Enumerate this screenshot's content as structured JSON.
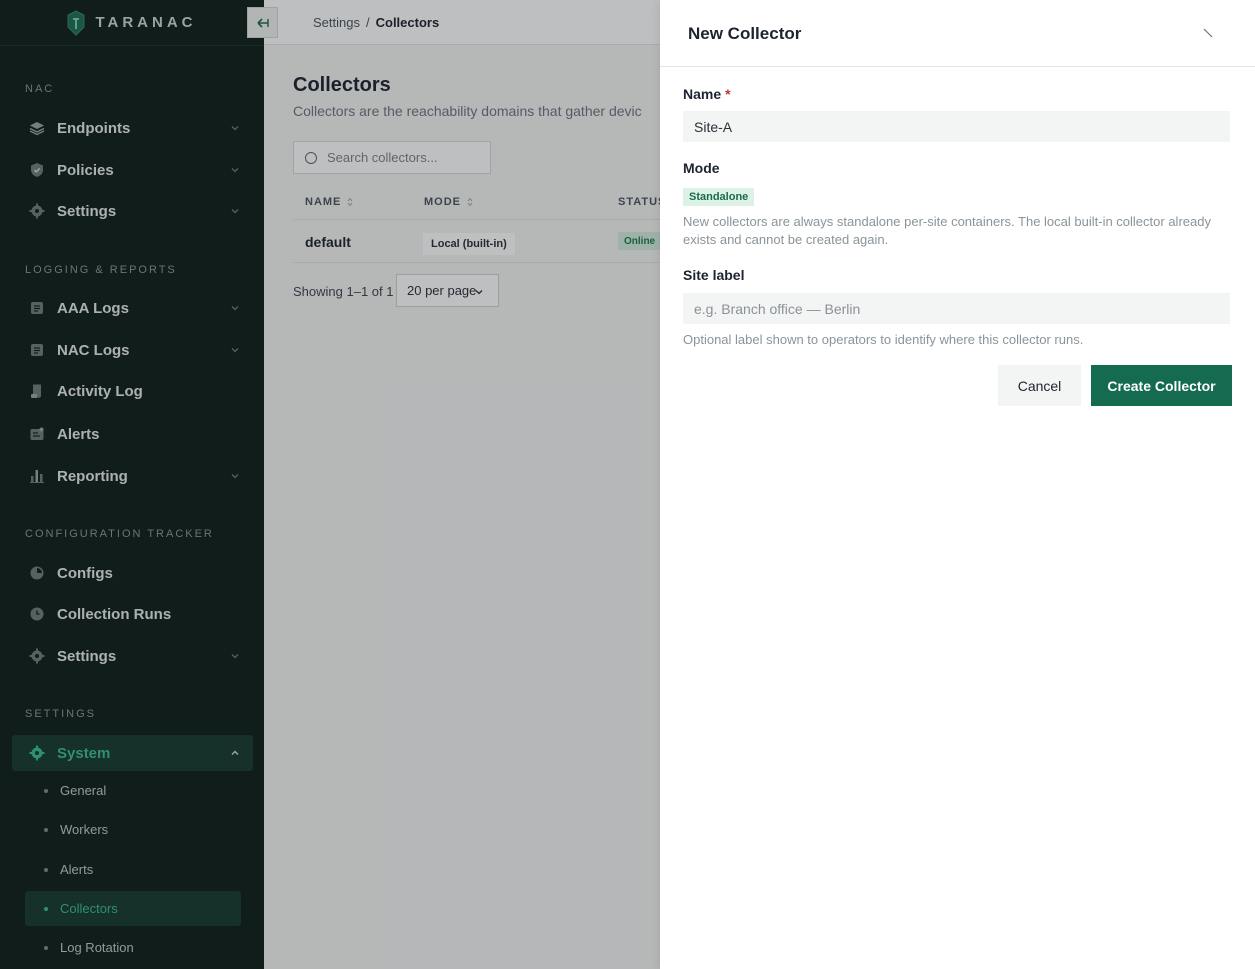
{
  "app": {
    "brand": "TARANAC"
  },
  "sidebar": {
    "sections": [
      {
        "title": "NAC",
        "items": [
          {
            "label": "Endpoints",
            "icon": "layers-icon",
            "chevron": true
          },
          {
            "label": "Policies",
            "icon": "shield-check-icon",
            "chevron": true
          },
          {
            "label": "Settings",
            "icon": "gear-icon",
            "chevron": true
          }
        ]
      },
      {
        "title": "LOGGING & REPORTS",
        "items": [
          {
            "label": "AAA Logs",
            "icon": "log-icon",
            "chevron": true
          },
          {
            "label": "NAC Logs",
            "icon": "log-icon",
            "chevron": true
          },
          {
            "label": "Activity Log",
            "icon": "scroll-icon",
            "chevron": false
          },
          {
            "label": "Alerts",
            "icon": "alert-icon",
            "chevron": false
          },
          {
            "label": "Reporting",
            "icon": "bar-chart-icon",
            "chevron": true
          }
        ]
      },
      {
        "title": "CONFIGURATION TRACKER",
        "items": [
          {
            "label": "Configs",
            "icon": "config-icon",
            "chevron": false
          },
          {
            "label": "Collection Runs",
            "icon": "clock-icon",
            "chevron": false
          },
          {
            "label": "Settings",
            "icon": "gear-icon",
            "chevron": true
          }
        ]
      },
      {
        "title": "SETTINGS",
        "items": [
          {
            "label": "System",
            "icon": "gear-icon",
            "chevron": true,
            "expanded": true,
            "active": true
          }
        ]
      }
    ],
    "system_subitems": [
      "General",
      "Workers",
      "Alerts",
      "Collectors",
      "Log Rotation"
    ],
    "active_subitem": "Collectors"
  },
  "breadcrumb": [
    "Settings",
    "Collectors"
  ],
  "page": {
    "title": "Collectors",
    "description": "Collectors are the reachability domains that gather devic",
    "search_placeholder": "Search collectors...",
    "columns": [
      "NAME",
      "MODE",
      "STATUS"
    ],
    "rows": [
      {
        "name": "default",
        "mode": "Local (built-in)",
        "status": "Online"
      }
    ],
    "showing": "Showing 1–1 of 1",
    "per_page": "20 per page"
  },
  "drawer": {
    "title": "New Collector",
    "name_label": "Name",
    "required_mark": "*",
    "name_value": "Site-A",
    "mode_label": "Mode",
    "mode_value": "Standalone",
    "mode_help": "New collectors are always standalone per-site containers. The local built-in collector already exists and cannot be created again.",
    "site_label": "Site label",
    "site_placeholder": "e.g. Branch office — Berlin",
    "site_help": "Optional label shown to operators to identify where this collector runs.",
    "cancel_label": "Cancel",
    "create_label": "Create Collector"
  },
  "colors": {
    "sidebar_bg": "#0f1f1b",
    "accent": "#3bbd8e",
    "primary_button": "#156b50",
    "status_online": "#1e7a50"
  }
}
